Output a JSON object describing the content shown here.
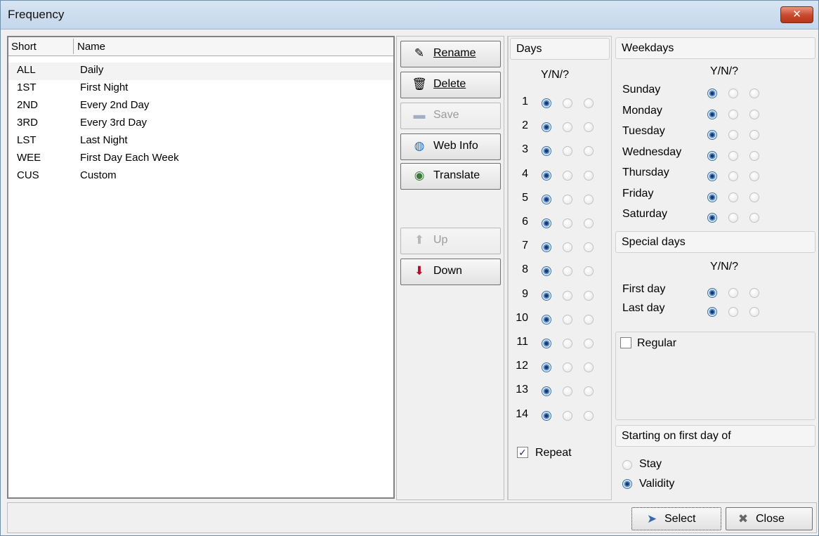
{
  "window": {
    "title": "Frequency",
    "close_glyph": "✕"
  },
  "grid": {
    "columns": [
      "Short",
      "Name"
    ],
    "rows": [
      {
        "short": "ALL",
        "name": "Daily"
      },
      {
        "short": "1ST",
        "name": "First Night"
      },
      {
        "short": "2ND",
        "name": "Every 2nd Day"
      },
      {
        "short": "3RD",
        "name": "Every 3rd Day"
      },
      {
        "short": "LST",
        "name": "Last Night"
      },
      {
        "short": "WEE",
        "name": "First Day Each Week"
      },
      {
        "short": "CUS",
        "name": "Custom"
      }
    ]
  },
  "buttons": {
    "rename": {
      "label": "Rename",
      "icon": "rename-icon",
      "glyph": "✎"
    },
    "delete": {
      "label": "Delete",
      "icon": "trash-icon",
      "glyph": "🗑"
    },
    "save": {
      "label": "Save",
      "icon": "floppy-icon",
      "glyph": "▬"
    },
    "web_info": {
      "label": "Web Info",
      "icon": "globe-icon",
      "glyph": "◍"
    },
    "translate": {
      "label": "Translate",
      "icon": "globe-stand-icon",
      "glyph": "◉"
    },
    "up": {
      "label": "Up",
      "icon": "arrow-up-icon",
      "glyph": "⬆"
    },
    "down": {
      "label": "Down",
      "icon": "arrow-down-icon",
      "glyph": "⬇"
    },
    "select": {
      "label": "Select",
      "icon": "cursor-icon",
      "glyph": "➤"
    },
    "close": {
      "label": "Close",
      "icon": "close-x-icon",
      "glyph": "✖"
    }
  },
  "days": {
    "title": "Days",
    "ynq": "Y/N/?",
    "numbers": [
      "1",
      "2",
      "3",
      "4",
      "5",
      "6",
      "7",
      "8",
      "9",
      "10",
      "11",
      "12",
      "13",
      "14"
    ],
    "selected": "Y",
    "repeat": {
      "label": "Repeat",
      "checked": true
    }
  },
  "weekdays": {
    "title": "Weekdays",
    "ynq": "Y/N/?",
    "items": [
      "Sunday",
      "Monday",
      "Tuesday",
      "Wednesday",
      "Thursday",
      "Friday",
      "Saturday"
    ],
    "selected": "Y"
  },
  "special_days": {
    "title": "Special days",
    "ynq": "Y/N/?",
    "items": [
      "First day",
      "Last day"
    ],
    "selected": "Y"
  },
  "regular": {
    "label": "Regular",
    "checked": false
  },
  "starting": {
    "title": "Starting on first day of",
    "options": [
      "Stay",
      "Validity"
    ],
    "selected": "Validity"
  },
  "colors": {
    "title_bar": "#c4d7ec",
    "close_button": "#c7482c",
    "panel_bg": "#f0f0f0"
  }
}
